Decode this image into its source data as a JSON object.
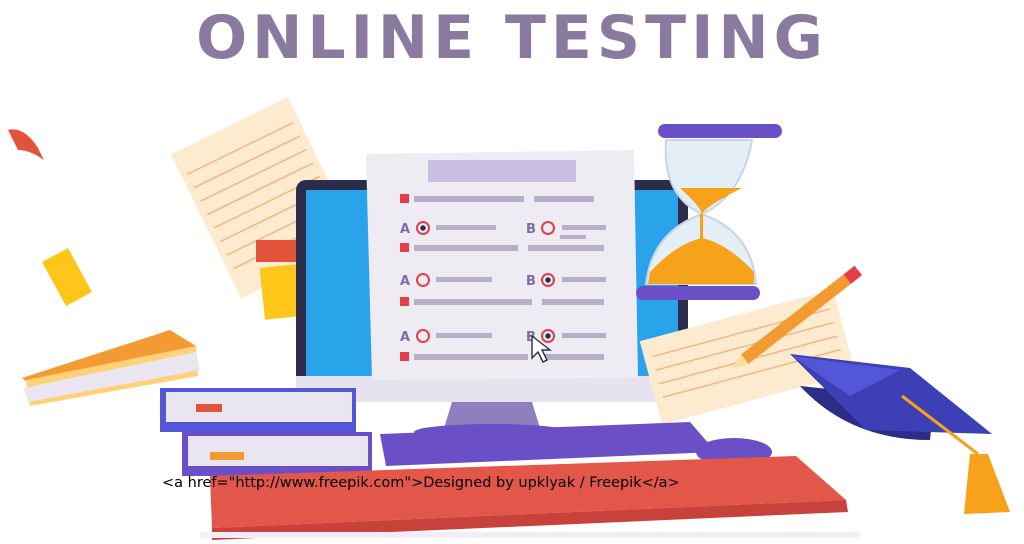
{
  "title": "ONLINE TESTING",
  "credit_text": "<a href=\"http://www.freepik.com\">Designed by upklyak / Freepik</a>",
  "quiz": {
    "questions": [
      {
        "options": [
          {
            "letter": "A",
            "selected": true
          },
          {
            "letter": "B",
            "selected": false
          }
        ]
      },
      {
        "options": [
          {
            "letter": "A",
            "selected": false
          },
          {
            "letter": "B",
            "selected": true
          }
        ]
      },
      {
        "options": [
          {
            "letter": "A",
            "selected": false
          },
          {
            "letter": "B",
            "selected": true
          }
        ]
      }
    ]
  },
  "colors": {
    "title": "#8a7aa0",
    "screen": "#29a3ea",
    "paper": "#eeebf3",
    "accent_red": "#e53e4a",
    "lines": "#b7afc8",
    "purple": "#6b4fc6",
    "orange": "#f7a21b",
    "yellow": "#ffc61a",
    "cap": "#3d3fb6",
    "desk": "#e3574a"
  },
  "icons": [
    "hourglass-icon",
    "pencil-icon",
    "graduation-cap-icon",
    "books-icon",
    "cursor-icon",
    "keyboard-icon",
    "mouse-icon"
  ]
}
